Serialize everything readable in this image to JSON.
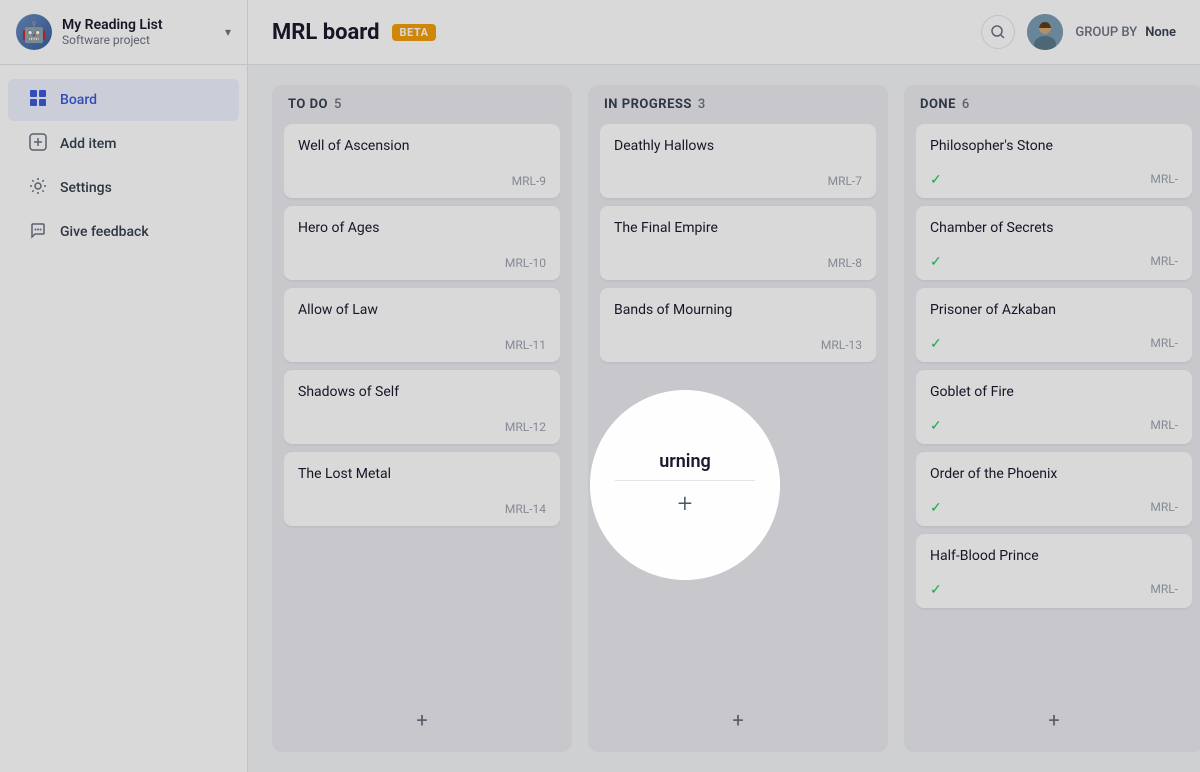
{
  "sidebar": {
    "project_name": "My Reading List",
    "project_sub": "Software project",
    "chevron": "▾",
    "nav_items": [
      {
        "id": "board",
        "icon": "⊞",
        "label": "Board",
        "active": true
      },
      {
        "id": "add-item",
        "icon": "⊕",
        "label": "Add item",
        "active": false
      },
      {
        "id": "settings",
        "icon": "⚙",
        "label": "Settings",
        "active": false
      },
      {
        "id": "give-feedback",
        "icon": "📣",
        "label": "Give feedback",
        "active": false
      }
    ]
  },
  "header": {
    "title": "MRL board",
    "beta_label": "BETA",
    "group_by_label": "GROUP BY",
    "group_by_value": "None"
  },
  "toolbar": {
    "search_placeholder": "Search"
  },
  "columns": [
    {
      "id": "todo",
      "title": "TO DO",
      "count": 5,
      "cards": [
        {
          "title": "Well of Ascension",
          "id": "MRL-9"
        },
        {
          "title": "Hero of Ages",
          "id": "MRL-10"
        },
        {
          "title": "Allow of Law",
          "id": "MRL-11"
        },
        {
          "title": "Shadows of Self",
          "id": "MRL-12"
        },
        {
          "title": "The Lost Metal",
          "id": "MRL-14"
        }
      ]
    },
    {
      "id": "inprogress",
      "title": "IN PROGRESS",
      "count": 3,
      "cards": [
        {
          "title": "Deathly Hallows",
          "id": "MRL-7"
        },
        {
          "title": "The Final Empire",
          "id": "MRL-8"
        },
        {
          "title": "Bands of Mourning",
          "id": "MRL-13"
        }
      ]
    },
    {
      "id": "done",
      "title": "DONE",
      "count": 6,
      "cards": [
        {
          "title": "Philosopher's Stone",
          "id": "MRL-",
          "done": true
        },
        {
          "title": "Chamber of Secrets",
          "id": "MRL-",
          "done": true
        },
        {
          "title": "Prisoner of Azkaban",
          "id": "MRL-",
          "done": true
        },
        {
          "title": "Goblet of Fire",
          "id": "MRL-",
          "done": true
        },
        {
          "title": "Order of the Phoenix",
          "id": "MRL-",
          "done": true
        },
        {
          "title": "Half-Blood Prince",
          "id": "MRL-",
          "done": true
        }
      ]
    }
  ],
  "spotlight": {
    "text": "urning",
    "plus_icon": "+"
  }
}
